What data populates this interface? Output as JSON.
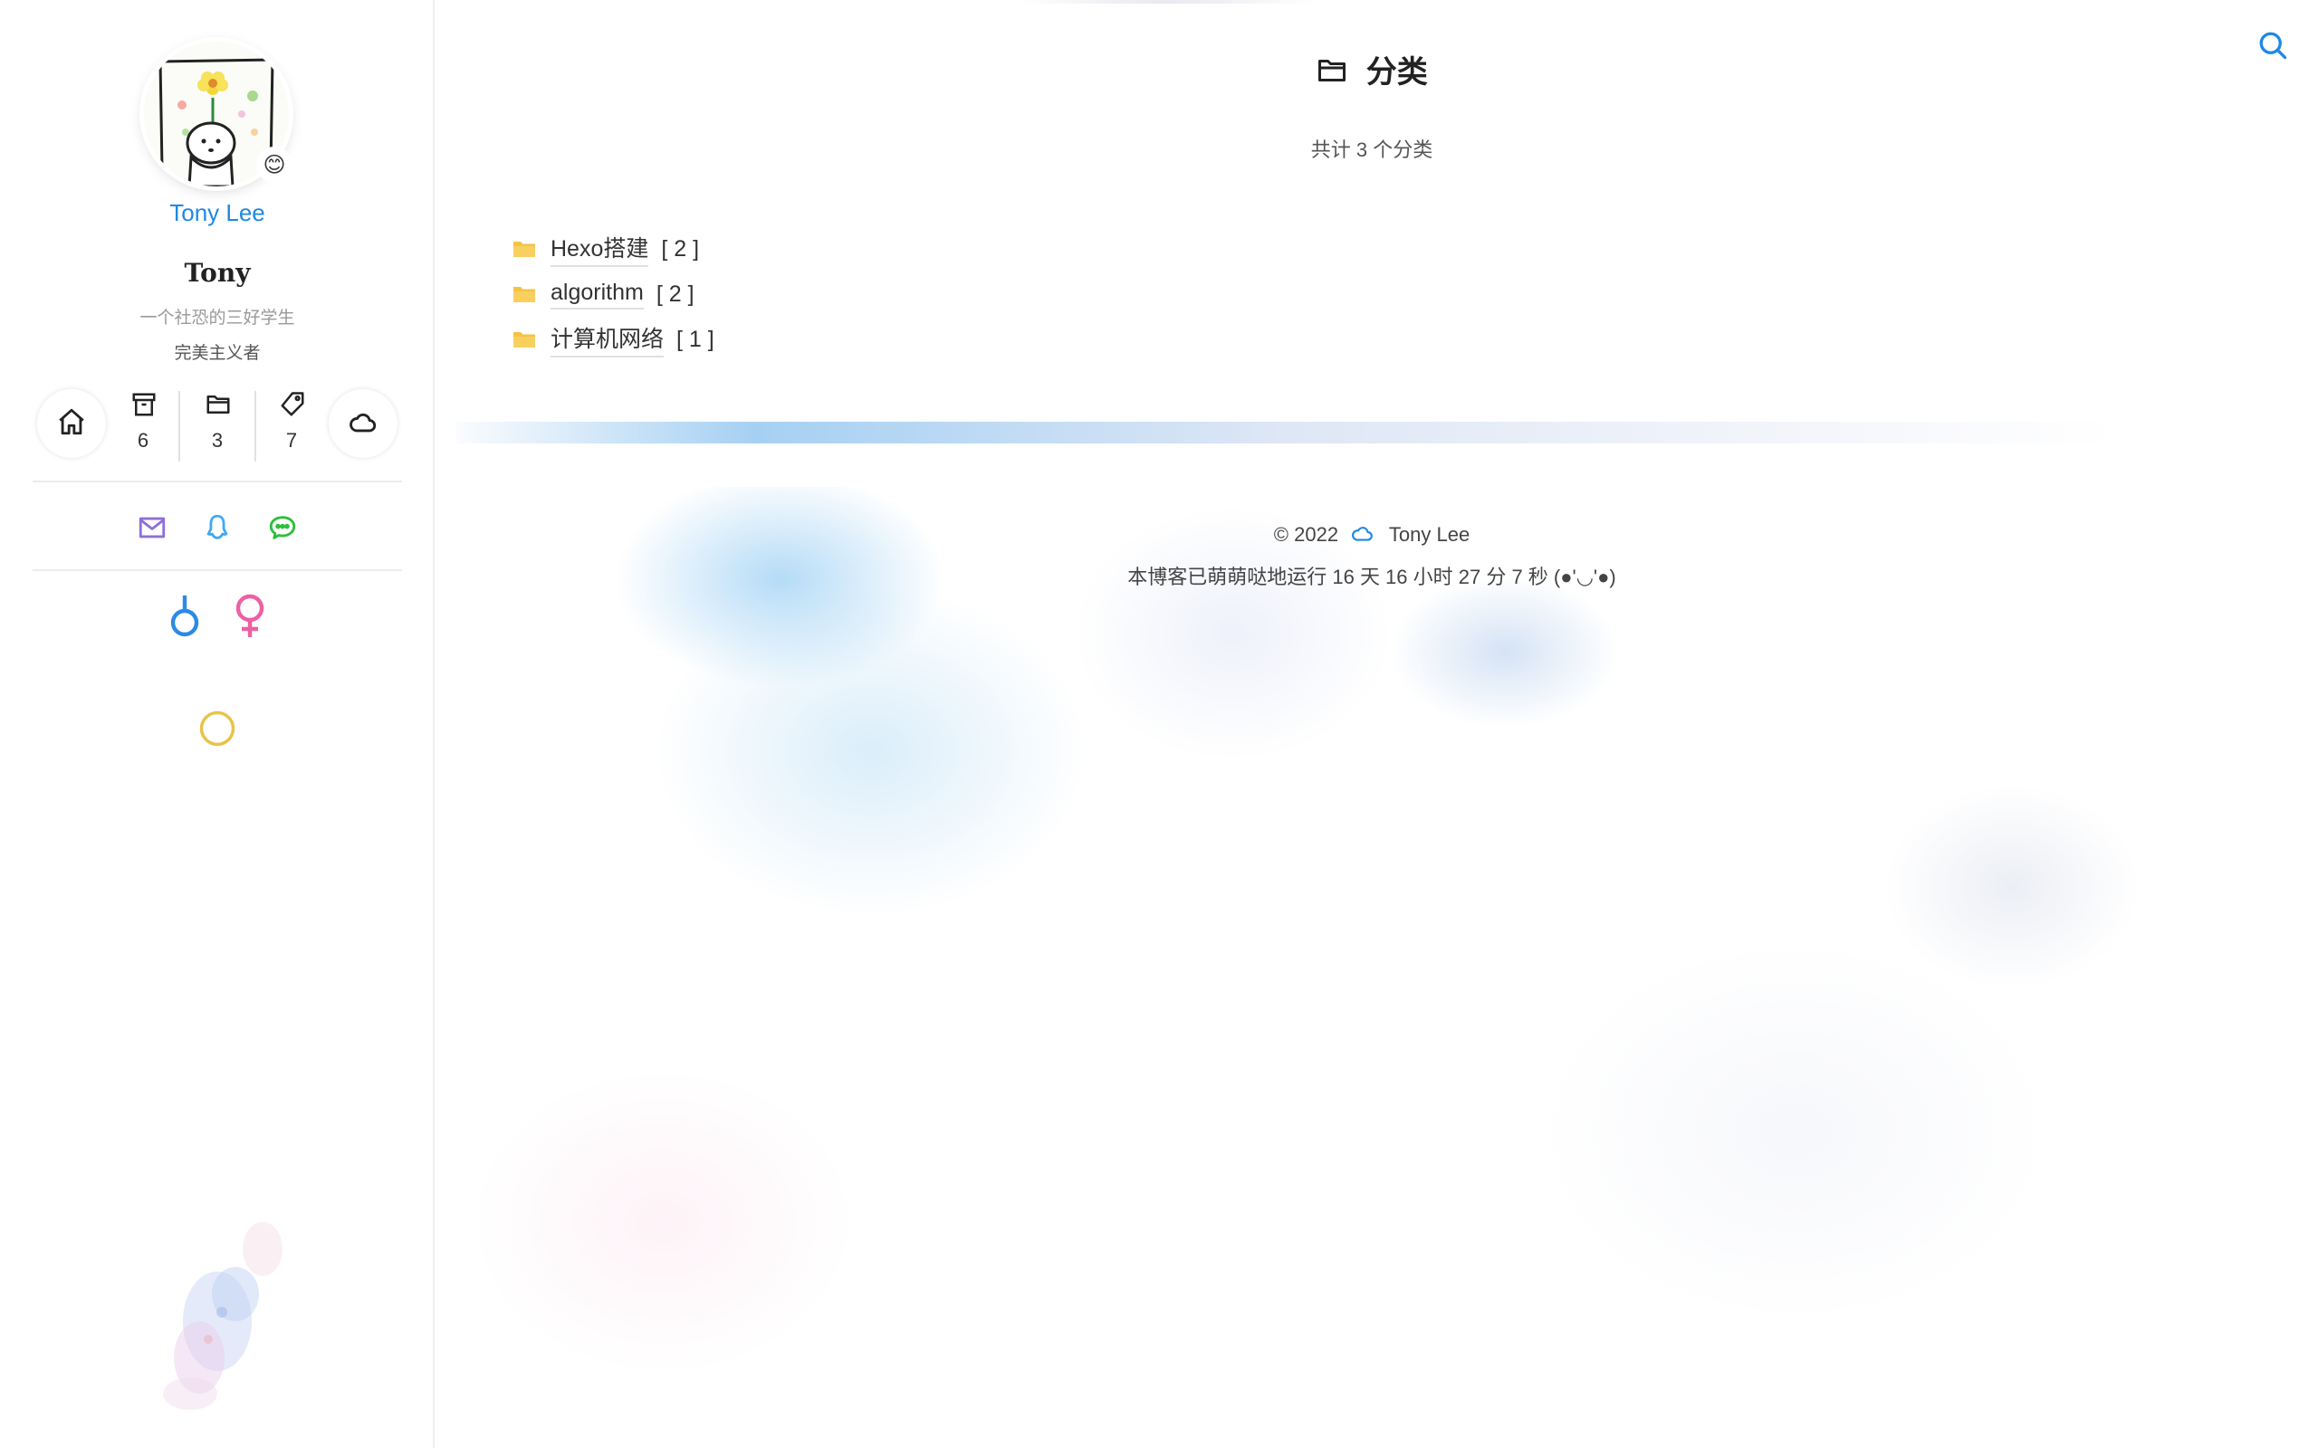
{
  "sidebar": {
    "author_name": "Tony Lee",
    "avatar_badge": "😊",
    "site_name": "Tony",
    "subtitle": "一个社恐的三好学生",
    "subtitle2": "完美主义者",
    "stats": {
      "archives": "6",
      "categories": "3",
      "tags": "7"
    },
    "icons": {
      "home": "home-icon",
      "archive": "archive-icon",
      "folder": "folder-icon",
      "tag": "tag-icon",
      "cloud": "cloud-icon",
      "mail": "mail-icon",
      "qq": "qq-icon",
      "wechat": "wechat-icon",
      "male": "male-icon",
      "female": "female-icon",
      "theme": "moon-icon"
    }
  },
  "header": {
    "title": "分类",
    "count_text": "共计 3 个分类"
  },
  "categories": [
    {
      "name": "Hexo搭建",
      "count": "[ 2 ]"
    },
    {
      "name": "algorithm",
      "count": "[ 2 ]"
    },
    {
      "name": "计算机网络",
      "count": "[ 1 ]"
    }
  ],
  "footer": {
    "copyright": "© 2022",
    "author": "Tony Lee",
    "runtime": "本博客已萌萌哒地运行 16 天 16 小时 27 分 7 秒 (●'◡'●)"
  },
  "colors": {
    "accent": "#1e88e5",
    "folder": "#f5c344",
    "mail": "#8e6fd6",
    "qq": "#3fa9f5",
    "wechat": "#2bbf3b",
    "male": "#2b8ae6",
    "female": "#ee5fa3",
    "theme": "#e8c24a"
  }
}
